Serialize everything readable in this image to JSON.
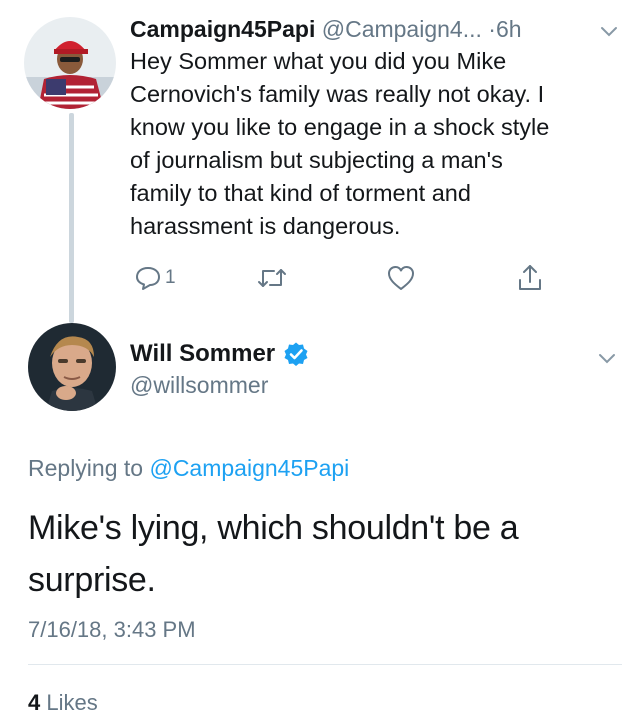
{
  "reply_tweet": {
    "author_name": "Campaign45Papi",
    "author_handle": "@Campaign4...",
    "time": "·6h",
    "text": "Hey Sommer what you did you Mike\nCernovich's family was really not okay. I\nknow you like to engage in a shock style\nof journalism but subjecting a man's\nfamily to that kind of torment and\nharassment is dangerous.",
    "reply_count": "1"
  },
  "main_tweet": {
    "author_name": "Will Sommer",
    "author_handle": "@willsommer",
    "replying_prefix": "Replying to",
    "replying_to": "@Campaign45Papi",
    "text": "Mike's lying, which shouldn't be a surprise.",
    "timestamp": "7/16/18, 3:43 PM",
    "likes_count": "4",
    "likes_label": "Likes"
  },
  "icons": {
    "reply": "reply-icon",
    "retweet": "retweet-icon",
    "like": "heart-icon",
    "share": "share-icon",
    "more": "chevron-down-icon",
    "verified": "verified-badge-icon"
  },
  "colors": {
    "text": "#14171a",
    "secondary": "#657786",
    "link": "#1da1f2",
    "verified": "#1da1f2",
    "divider": "#e1e8ed",
    "thread_line": "#ccd6dd"
  }
}
